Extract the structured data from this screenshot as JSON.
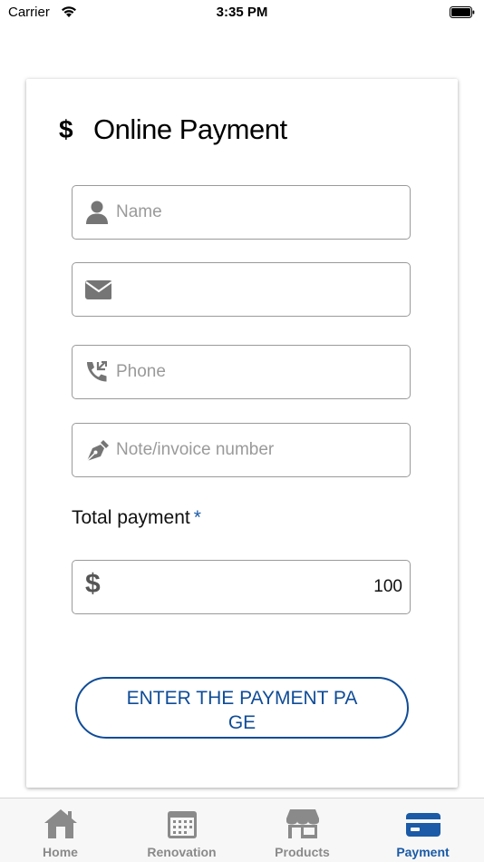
{
  "status_bar": {
    "carrier": "Carrier",
    "time": "3:35 PM"
  },
  "form": {
    "title_icon": "$",
    "title": "Online Payment",
    "name": {
      "icon": "user-icon",
      "placeholder": "Name",
      "value": ""
    },
    "email": {
      "icon": "envelope-icon",
      "placeholder": "",
      "value": ""
    },
    "phone": {
      "icon": "phone-icon",
      "placeholder": "Phone",
      "value": ""
    },
    "note": {
      "icon": "pen-nib-icon",
      "placeholder": "Note/invoice number",
      "value": ""
    },
    "total_label": "Total payment",
    "required_marker": "*",
    "amount": {
      "icon": "$",
      "value": "100"
    },
    "submit_label": "ENTER THE PAYMENT PA GE"
  },
  "tab_bar": {
    "items": [
      {
        "label": "Home",
        "icon": "home-icon",
        "active": false
      },
      {
        "label": "Renovation",
        "icon": "calendar-icon",
        "active": false
      },
      {
        "label": "Products",
        "icon": "store-icon",
        "active": false
      },
      {
        "label": "Payment",
        "icon": "credit-card-icon",
        "active": true
      }
    ]
  },
  "colors": {
    "accent": "#1a5aa6",
    "button_border": "#0f4c97",
    "inactive_tab": "#8a8a8a",
    "field_border": "#9a9a9a"
  }
}
